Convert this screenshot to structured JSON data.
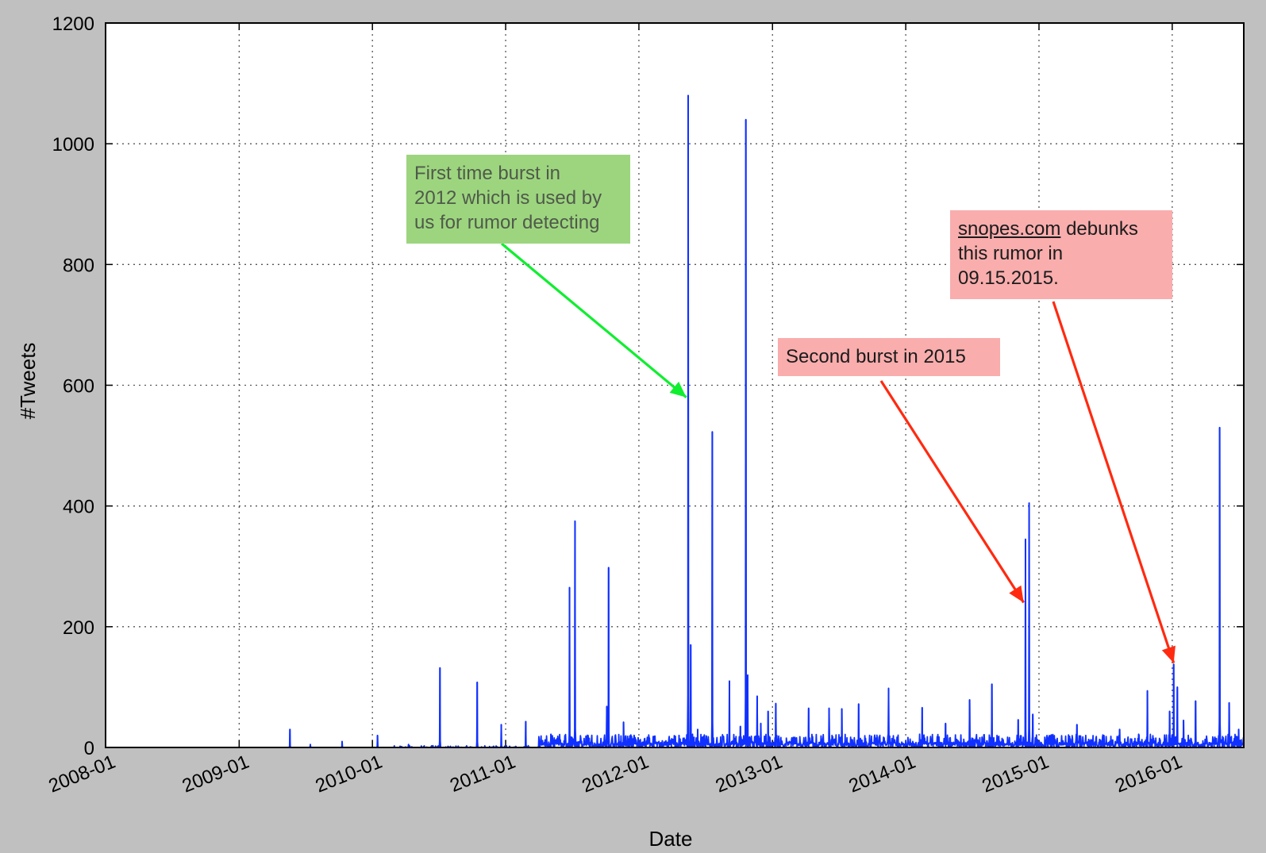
{
  "chart_data": {
    "type": "line",
    "xlabel": "Date",
    "ylabel": "#Tweets",
    "ylim": [
      0,
      1200
    ],
    "yticks": [
      "0",
      "200",
      "400",
      "600",
      "800",
      "1000",
      "1200"
    ],
    "xlim": [
      "2008-01-01",
      "2016-07-15"
    ],
    "xticks": [
      "2008-01",
      "2009-01",
      "2010-01",
      "2011-01",
      "2012-01",
      "2013-01",
      "2014-01",
      "2015-01",
      "2016-01"
    ],
    "grid": true,
    "series": [
      {
        "color": "#1030ff",
        "spikes": [
          [
            "2009-05-20",
            30
          ],
          [
            "2009-07-15",
            5
          ],
          [
            "2009-10-10",
            10
          ],
          [
            "2010-01-15",
            20
          ],
          [
            "2010-04-10",
            5
          ],
          [
            "2010-07-05",
            132
          ],
          [
            "2010-10-15",
            108
          ],
          [
            "2010-12-20",
            38
          ],
          [
            "2011-02-25",
            43
          ],
          [
            "2011-05-05",
            22
          ],
          [
            "2011-06-25",
            265
          ],
          [
            "2011-07-10",
            375
          ],
          [
            "2011-10-05",
            68
          ],
          [
            "2011-10-10",
            298
          ],
          [
            "2011-11-20",
            42
          ],
          [
            "2012-04-20",
            20
          ],
          [
            "2012-05-15",
            1080
          ],
          [
            "2012-05-22",
            170
          ],
          [
            "2012-06-10",
            30
          ],
          [
            "2012-07-20",
            523
          ],
          [
            "2012-09-05",
            110
          ],
          [
            "2012-10-05",
            35
          ],
          [
            "2012-10-20",
            1040
          ],
          [
            "2012-10-25",
            120
          ],
          [
            "2012-11-20",
            85
          ],
          [
            "2012-11-30",
            40
          ],
          [
            "2012-12-20",
            60
          ],
          [
            "2013-01-10",
            73
          ],
          [
            "2013-04-10",
            65
          ],
          [
            "2013-06-05",
            65
          ],
          [
            "2013-07-10",
            64
          ],
          [
            "2013-08-25",
            72
          ],
          [
            "2013-11-15",
            98
          ],
          [
            "2014-02-15",
            66
          ],
          [
            "2014-04-20",
            40
          ],
          [
            "2014-06-25",
            79
          ],
          [
            "2014-08-25",
            105
          ],
          [
            "2014-11-05",
            46
          ],
          [
            "2014-11-25",
            345
          ],
          [
            "2014-12-05",
            405
          ],
          [
            "2014-12-15",
            55
          ],
          [
            "2015-04-15",
            38
          ],
          [
            "2015-08-10",
            30
          ],
          [
            "2015-10-25",
            94
          ],
          [
            "2015-12-25",
            60
          ],
          [
            "2016-01-05",
            138
          ],
          [
            "2016-01-15",
            100
          ],
          [
            "2016-02-01",
            45
          ],
          [
            "2016-03-05",
            77
          ],
          [
            "2016-05-10",
            530
          ],
          [
            "2016-06-05",
            74
          ],
          [
            "2016-07-01",
            30
          ]
        ]
      }
    ]
  },
  "annotations": {
    "first_burst": {
      "lines": [
        "First time burst in",
        "2012 which is used by",
        "us for rumor detecting"
      ],
      "color": "#9dd57f",
      "arrow_color": "#10ee30",
      "target": [
        "2012-05-10",
        580
      ]
    },
    "second_burst": {
      "lines": [
        "Second burst in 2015"
      ],
      "color": "#f9adad",
      "arrow_color": "#ff2a10",
      "target": [
        "2014-11-20",
        240
      ]
    },
    "snopes": {
      "link": "snopes.com",
      "line1_rest": " debunks",
      "lines": [
        "this rumor in",
        "09.15.2015."
      ],
      "color": "#f9adad",
      "arrow_color": "#ff2a10",
      "target": [
        "2016-01-05",
        140
      ]
    }
  }
}
